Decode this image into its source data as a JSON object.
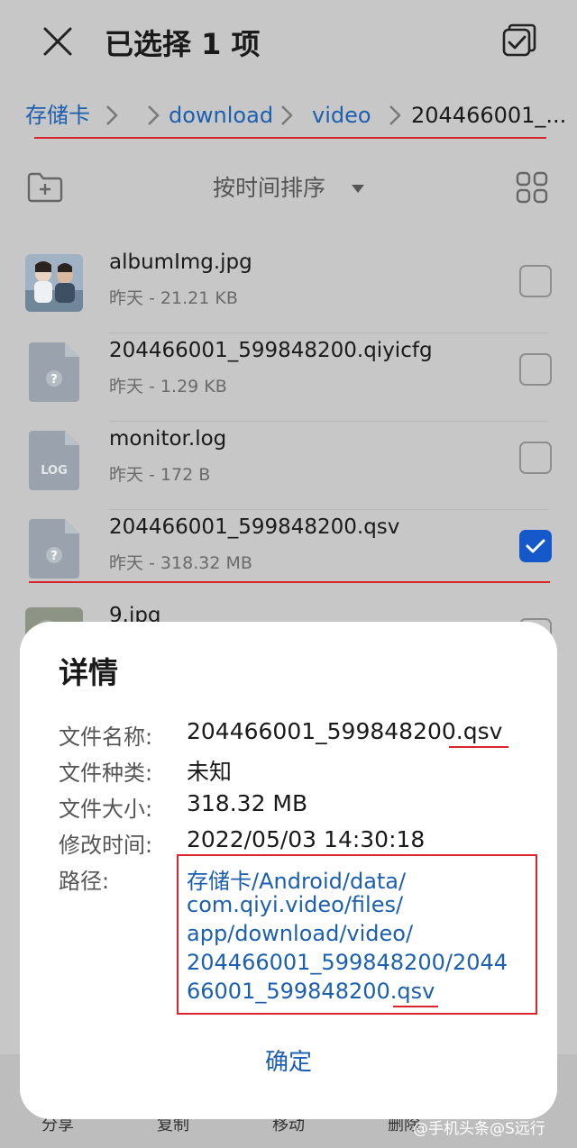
{
  "header": {
    "title": "已选择 1 项"
  },
  "breadcrumb": {
    "items": [
      "存储卡",
      "download",
      "video",
      "204466001_..."
    ]
  },
  "toolbar": {
    "sort_label": "按时间排序"
  },
  "files": [
    {
      "name": "albumImg.jpg",
      "meta": "昨天 - 21.21 KB",
      "checked": false
    },
    {
      "name": "204466001_599848200.qiyicfg",
      "meta": "昨天 - 1.29 KB",
      "checked": false
    },
    {
      "name": "monitor.log",
      "meta": "昨天 - 172 B",
      "checked": false,
      "icon_text": "LOG"
    },
    {
      "name": "204466001_599848200.qsv",
      "meta": "昨天 - 318.32 MB",
      "checked": true
    },
    {
      "name": "9.jpg"
    }
  ],
  "bottom_bar": {
    "items": [
      "分享",
      "复制",
      "移动",
      "删除"
    ]
  },
  "dialog": {
    "title": "详情",
    "labels": {
      "name": "文件名称:",
      "type": "文件种类:",
      "size": "文件大小:",
      "modified": "修改时间:",
      "path": "路径:"
    },
    "values": {
      "name": "204466001_599848200.qsv",
      "type": "未知",
      "size": "318.32 MB",
      "modified": "2022/05/03 14:30:18",
      "path_lines": [
        "存储卡/Android/data/",
        "com.qiyi.video/files/",
        "app/download/video/",
        "204466001_599848200/2044",
        "66001_599848200.qsv"
      ]
    },
    "ok_label": "确定"
  },
  "watermark": "@手机头条@S远行",
  "colors": {
    "accent": "#1c5fb0",
    "checkbox_checked": "#1558c9",
    "annotation_red": "#d8242a"
  }
}
